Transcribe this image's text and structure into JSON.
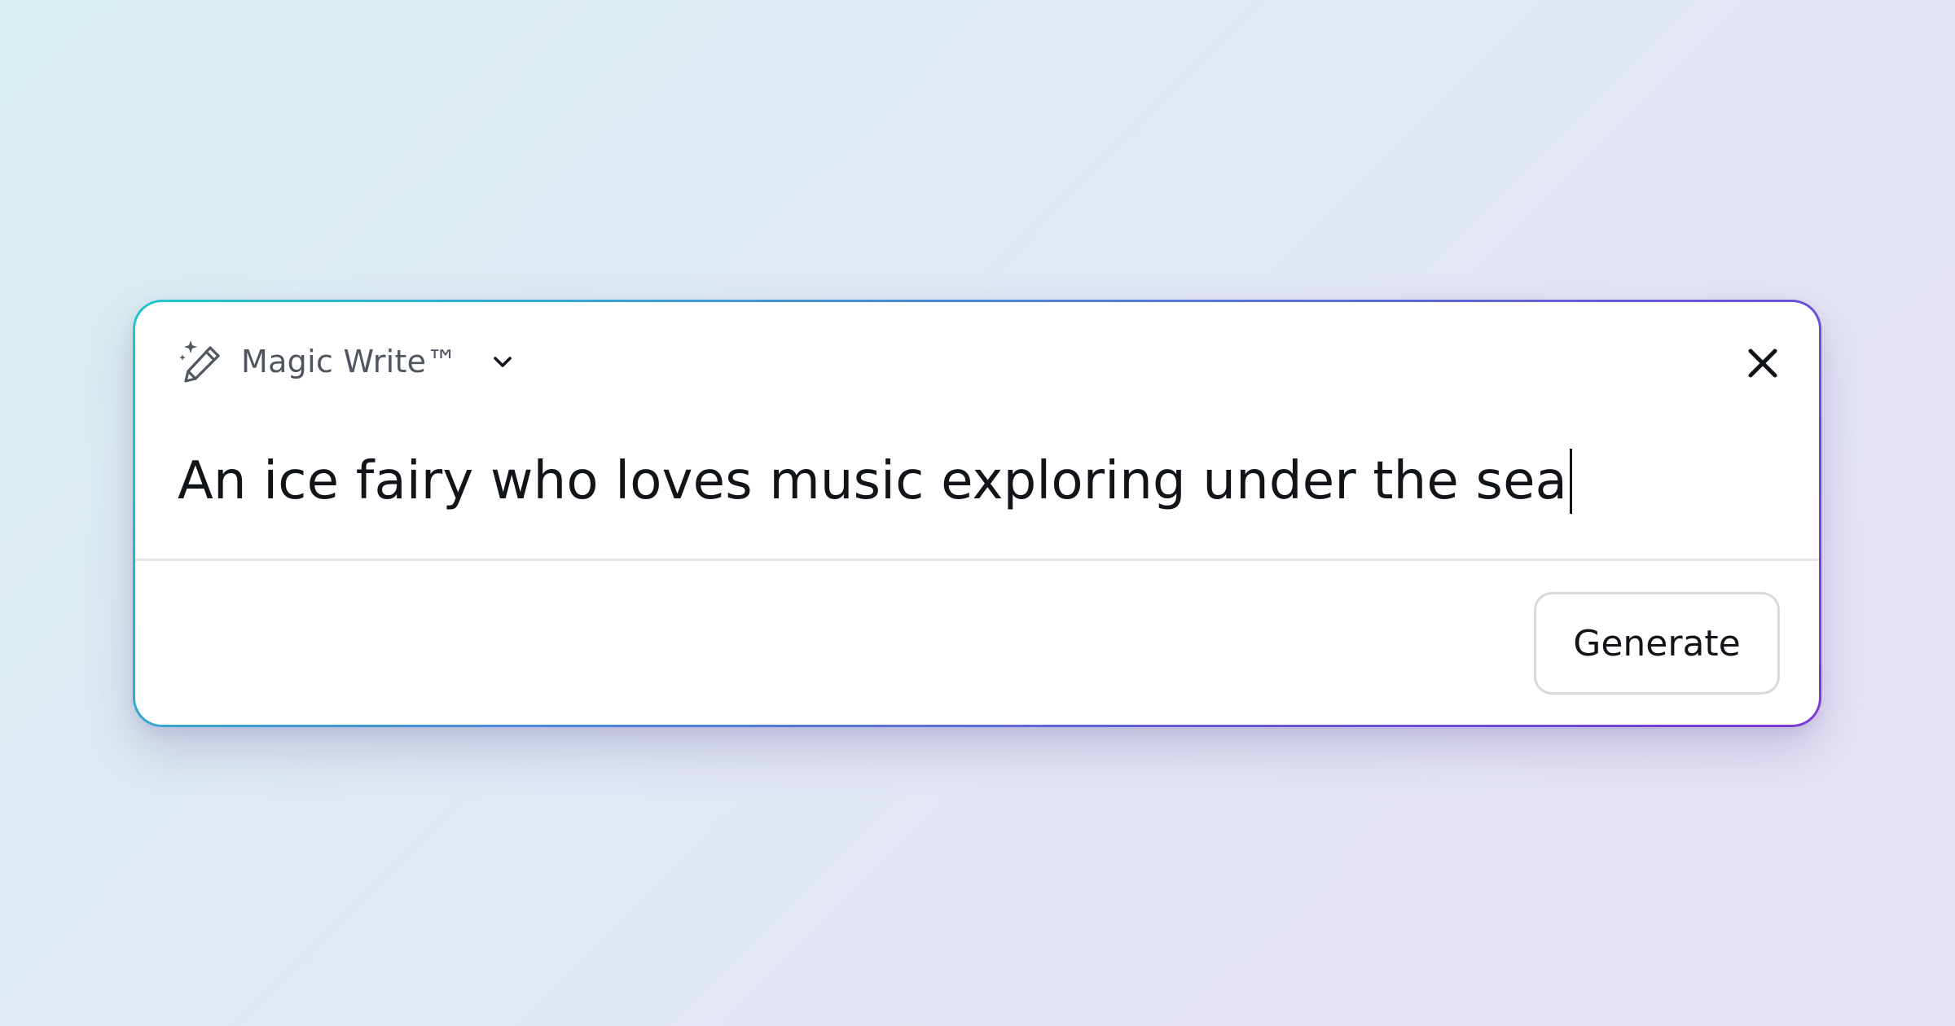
{
  "dialog": {
    "mode_label": "Magic Write™",
    "mode_icon": "magic-wand-pencil-icon",
    "dropdown_icon": "chevron-down-icon",
    "close_icon": "close-icon",
    "prompt_text": "An ice fairy who loves music exploring under the sea",
    "generate_label": "Generate"
  },
  "colors": {
    "border_gradient_start": "#22c6c9",
    "border_gradient_end": "#7b38d8",
    "text_primary": "#111418",
    "text_secondary": "#4f5660"
  }
}
